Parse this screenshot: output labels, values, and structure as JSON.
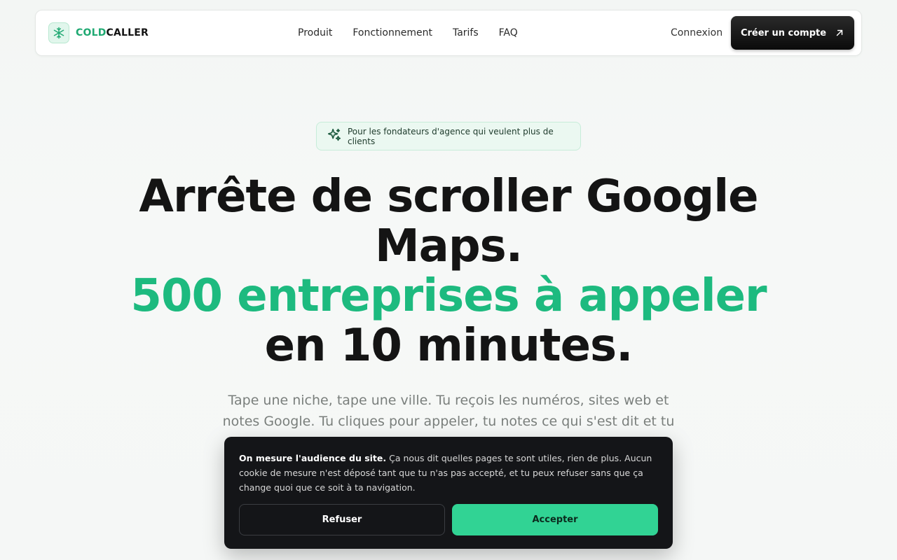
{
  "brand": {
    "cold": "COLD",
    "caller": "CALLER",
    "accent": "#1fa972"
  },
  "nav": {
    "links": [
      "Produit",
      "Fonctionnement",
      "Tarifs",
      "FAQ"
    ],
    "login": "Connexion",
    "cta": "Créer un compte",
    "cta_icon": "arrow-up-right-icon"
  },
  "hero": {
    "badge": "Pour les fondateurs d'agence qui veulent plus de clients",
    "badge_icon": "sparkles-icon",
    "title_line1": "Arrête de scroller Google",
    "title_line2": "Maps.",
    "title_line3": "500 entreprises à appeler",
    "title_line4": "en 10 minutes.",
    "accent_color": "#1dba7f",
    "subtitle": "Tape une niche, tape une ville. Tu reçois les numéros, sites web et notes Google. Tu cliques pour appeler, tu notes ce qui s'est dit et tu sais"
  },
  "cookie": {
    "title": "On mesure l'audience du site.",
    "body": " Ça nous dit quelles pages te sont utiles, rien de plus. Aucun cookie de mesure n'est déposé tant que tu n'as pas accepté, et tu peux refuser sans que ça change quoi que ce soit à ta navigation.",
    "refuse": "Refuser",
    "accept": "Accepter",
    "accept_color": "#31d394"
  }
}
